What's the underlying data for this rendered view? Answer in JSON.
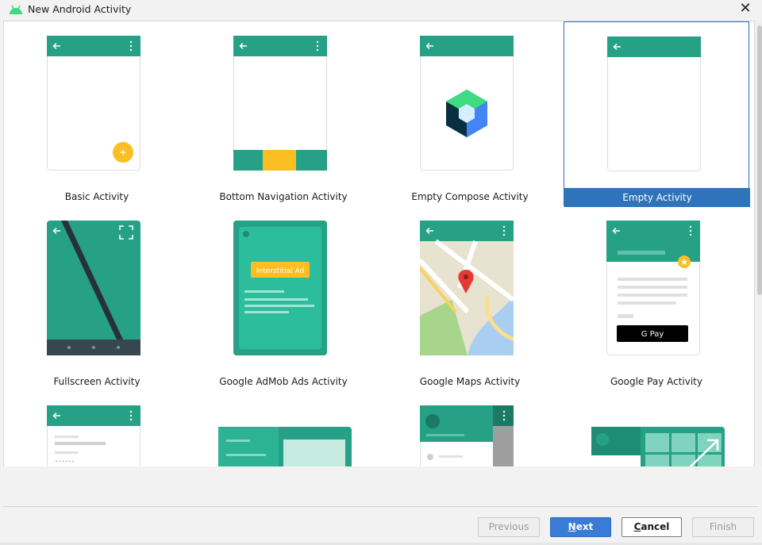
{
  "window": {
    "title": "New Android Activity",
    "close_glyph": "✕"
  },
  "colors": {
    "teal": "#26a186",
    "teal_dark": "#1b7a66",
    "amber": "#fbbf24",
    "selection": "#2f73bb"
  },
  "templates": [
    {
      "label": "Basic Activity"
    },
    {
      "label": "Bottom Navigation Activity"
    },
    {
      "label": "Empty Compose Activity"
    },
    {
      "label": "Empty Activity",
      "selected": true
    },
    {
      "label": "Fullscreen Activity"
    },
    {
      "label": "Google AdMob Ads Activity",
      "ad_text": "Interstitial Ad"
    },
    {
      "label": "Google Maps Activity"
    },
    {
      "label": "Google Pay Activity",
      "pay_text": "G Pay"
    }
  ],
  "buttons": {
    "previous": "Previous",
    "next": {
      "mnemonic": "N",
      "rest": "ext"
    },
    "cancel": {
      "mnemonic": "C",
      "rest": "ancel"
    },
    "finish": "Finish"
  }
}
